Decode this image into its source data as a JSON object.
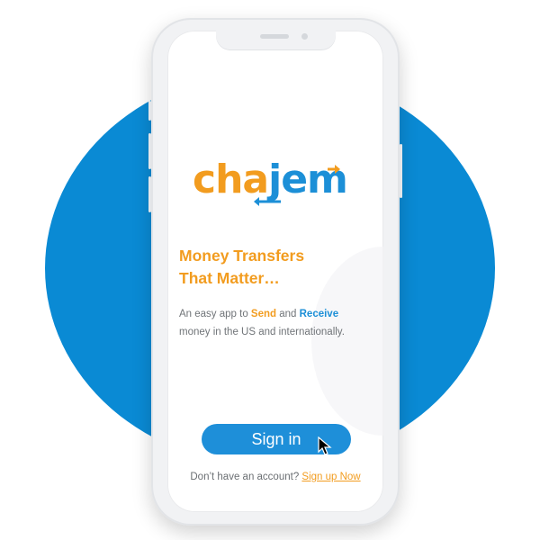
{
  "colors": {
    "brand_blue": "#1e8fd9",
    "brand_orange": "#f29c1f",
    "background_circle": "#0a8ad4"
  },
  "logo": {
    "part1": "cha",
    "part2": "jem"
  },
  "headline": {
    "line1": "Money Transfers",
    "line2": "That Matter…"
  },
  "description": {
    "prefix": "An easy app to ",
    "send": "Send",
    "and": " and ",
    "receive": "Receive",
    "suffix": "money in the US and internationally."
  },
  "signin_button": {
    "label": "Sign in"
  },
  "signup": {
    "prompt": "Don’t have an account? ",
    "link_label": "Sign up Now"
  },
  "cursor": {
    "icon": "arrow-pointer-icon"
  }
}
